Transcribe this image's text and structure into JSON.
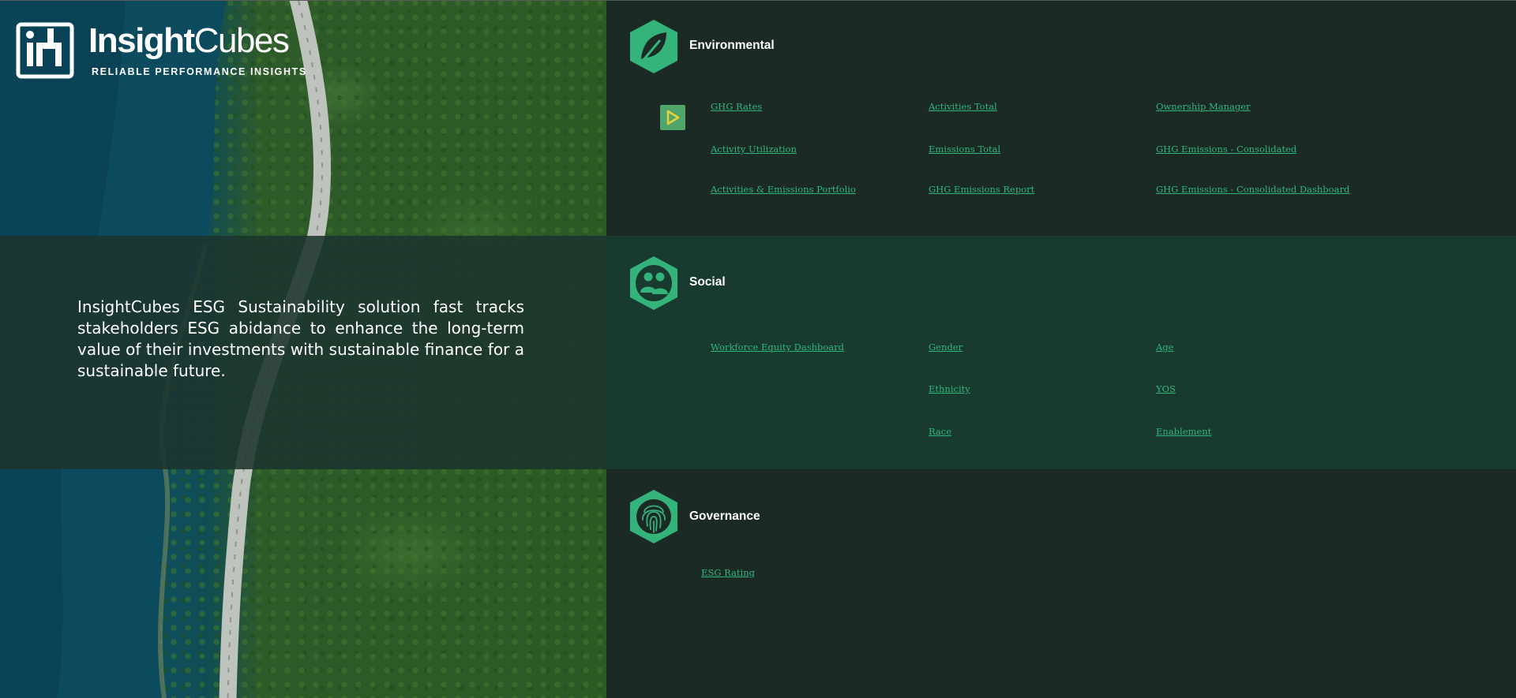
{
  "brand": {
    "name_bold": "Insight",
    "name_light": "Cubes",
    "tagline": "RELIABLE PERFORMANCE INSIGHTS",
    "logo_icon": "insightcubes-logo-icon"
  },
  "intro_text": "InsightCubes ESG Sustainability solution fast tracks stakeholders ESG abidance to enhance the long-term value of their investments with sustainable finance for a sustainable future.",
  "colors": {
    "accent": "#2fb67a",
    "icon_green": "#34b37a",
    "env_bg": "#1c2a26",
    "social_bg": "#193a2e",
    "play_bg": "#4fa56a",
    "play_arrow": "#e8d23a"
  },
  "environmental": {
    "title": "Environmental",
    "icon": "leaf-icon",
    "play_icon": "play-icon",
    "links": {
      "ghg_rates": "GHG Rates",
      "activities_total": "Activities Total",
      "ownership_manager": "Ownership Manager",
      "activity_utilization": "Activity Utilization",
      "emissions_total": "Emissions Total",
      "ghg_consolidated": "GHG Emissions - Consolidated",
      "activities_emissions_portfolio": "Activities & Emissions Portfolio",
      "ghg_report": "GHG Emissions Report",
      "ghg_consolidated_dashboard": "GHG Emissions - Consolidated Dashboard"
    }
  },
  "social": {
    "title": "Social",
    "icon": "people-icon",
    "links": {
      "workforce_equity": "Workforce Equity Dashboard",
      "gender": "Gender",
      "age": "Age",
      "ethnicity": "Ethnicity",
      "yos": "YOS",
      "race": "Race",
      "enablement": "Enablement"
    }
  },
  "governance": {
    "title": "Governance",
    "icon": "fingerprint-icon",
    "links": {
      "esg_rating": "ESG Rating"
    }
  }
}
